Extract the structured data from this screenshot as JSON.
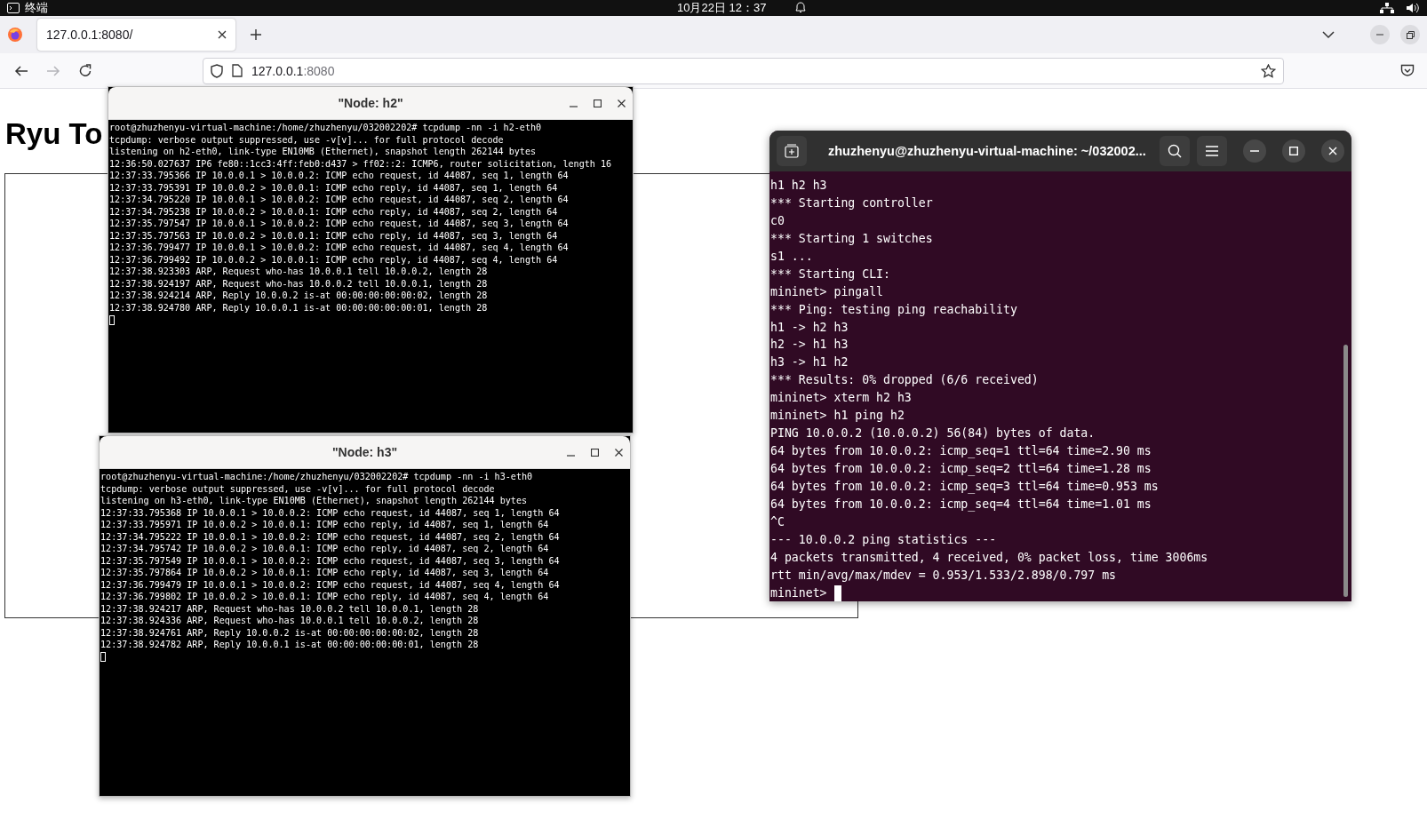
{
  "top_bar": {
    "app_label": "终端",
    "clock": "10月22日 12：37"
  },
  "browser": {
    "tabs": [
      {
        "title": "127.0.0.1:8080/",
        "selected": true
      }
    ],
    "nav_buttons": [
      {
        "kind": "back",
        "disabled": false
      },
      {
        "kind": "forward",
        "disabled": true
      },
      {
        "kind": "reload",
        "disabled": false
      }
    ],
    "url": {
      "host": "127.0.0.1",
      "rest": ":8080"
    },
    "page": {
      "heading": "Ryu To"
    }
  },
  "windows": [
    {
      "kind": "xterm",
      "title": "\"Node: h2\"",
      "cursor": true,
      "lines": [
        "root@zhuzhenyu-virtual-machine:/home/zhuzhenyu/032002202# tcpdump -nn -i h2-eth0",
        "tcpdump: verbose output suppressed, use -v[v]... for full protocol decode",
        "listening on h2-eth0, link-type EN10MB (Ethernet), snapshot length 262144 bytes",
        "12:36:50.027637 IP6 fe80::1cc3:4ff:feb0:d437 > ff02::2: ICMP6, router solicitation, length 16",
        "12:37:33.795366 IP 10.0.0.1 > 10.0.0.2: ICMP echo request, id 44087, seq 1, length 64",
        "12:37:33.795391 IP 10.0.0.2 > 10.0.0.1: ICMP echo reply, id 44087, seq 1, length 64",
        "12:37:34.795220 IP 10.0.0.1 > 10.0.0.2: ICMP echo request, id 44087, seq 2, length 64",
        "12:37:34.795238 IP 10.0.0.2 > 10.0.0.1: ICMP echo reply, id 44087, seq 2, length 64",
        "12:37:35.797547 IP 10.0.0.1 > 10.0.0.2: ICMP echo request, id 44087, seq 3, length 64",
        "12:37:35.797563 IP 10.0.0.2 > 10.0.0.1: ICMP echo reply, id 44087, seq 3, length 64",
        "12:37:36.799477 IP 10.0.0.1 > 10.0.0.2: ICMP echo request, id 44087, seq 4, length 64",
        "12:37:36.799492 IP 10.0.0.2 > 10.0.0.1: ICMP echo reply, id 44087, seq 4, length 64",
        "12:37:38.923303 ARP, Request who-has 10.0.0.1 tell 10.0.0.2, length 28",
        "12:37:38.924197 ARP, Request who-has 10.0.0.2 tell 10.0.0.1, length 28",
        "12:37:38.924214 ARP, Reply 10.0.0.2 is-at 00:00:00:00:00:02, length 28",
        "12:37:38.924780 ARP, Reply 10.0.0.1 is-at 00:00:00:00:00:01, length 28"
      ]
    },
    {
      "kind": "xterm",
      "title": "\"Node: h3\"",
      "cursor": true,
      "lines": [
        "root@zhuzhenyu-virtual-machine:/home/zhuzhenyu/032002202# tcpdump -nn -i h3-eth0",
        "tcpdump: verbose output suppressed, use -v[v]... for full protocol decode",
        "listening on h3-eth0, link-type EN10MB (Ethernet), snapshot length 262144 bytes",
        "12:37:33.795368 IP 10.0.0.1 > 10.0.0.2: ICMP echo request, id 44087, seq 1, length 64",
        "12:37:33.795971 IP 10.0.0.2 > 10.0.0.1: ICMP echo reply, id 44087, seq 1, length 64",
        "12:37:34.795222 IP 10.0.0.1 > 10.0.0.2: ICMP echo request, id 44087, seq 2, length 64",
        "12:37:34.795742 IP 10.0.0.2 > 10.0.0.1: ICMP echo reply, id 44087, seq 2, length 64",
        "12:37:35.797549 IP 10.0.0.1 > 10.0.0.2: ICMP echo request, id 44087, seq 3, length 64",
        "12:37:35.797864 IP 10.0.0.2 > 10.0.0.1: ICMP echo reply, id 44087, seq 3, length 64",
        "12:37:36.799479 IP 10.0.0.1 > 10.0.0.2: ICMP echo request, id 44087, seq 4, length 64",
        "12:37:36.799802 IP 10.0.0.2 > 10.0.0.1: ICMP echo reply, id 44087, seq 4, length 64",
        "12:37:38.924217 ARP, Request who-has 10.0.0.2 tell 10.0.0.1, length 28",
        "12:37:38.924336 ARP, Request who-has 10.0.0.1 tell 10.0.0.2, length 28",
        "12:37:38.924761 ARP, Reply 10.0.0.2 is-at 00:00:00:00:00:02, length 28",
        "12:37:38.924782 ARP, Reply 10.0.0.1 is-at 00:00:00:00:00:01, length 28"
      ]
    },
    {
      "kind": "gnome",
      "title": "zhuzhenyu@zhuzhenyu-virtual-machine: ~/032002...",
      "cursor": true,
      "lines": [
        "h1 h2 h3",
        "*** Starting controller",
        "c0",
        "*** Starting 1 switches",
        "s1 ...",
        "*** Starting CLI:",
        "mininet> pingall",
        "*** Ping: testing ping reachability",
        "h1 -> h2 h3",
        "h2 -> h1 h3",
        "h3 -> h1 h2",
        "*** Results: 0% dropped (6/6 received)",
        "mininet> xterm h2 h3",
        "mininet> h1 ping h2",
        "PING 10.0.0.2 (10.0.0.2) 56(84) bytes of data.",
        "64 bytes from 10.0.0.2: icmp_seq=1 ttl=64 time=2.90 ms",
        "64 bytes from 10.0.0.2: icmp_seq=2 ttl=64 time=1.28 ms",
        "64 bytes from 10.0.0.2: icmp_seq=3 ttl=64 time=0.953 ms",
        "64 bytes from 10.0.0.2: icmp_seq=4 ttl=64 time=1.01 ms",
        "^C",
        "--- 10.0.0.2 ping statistics ---",
        "4 packets transmitted, 4 received, 0% packet loss, time 3006ms",
        "rtt min/avg/max/mdev = 0.953/1.533/2.898/0.797 ms",
        "mininet>"
      ]
    }
  ]
}
